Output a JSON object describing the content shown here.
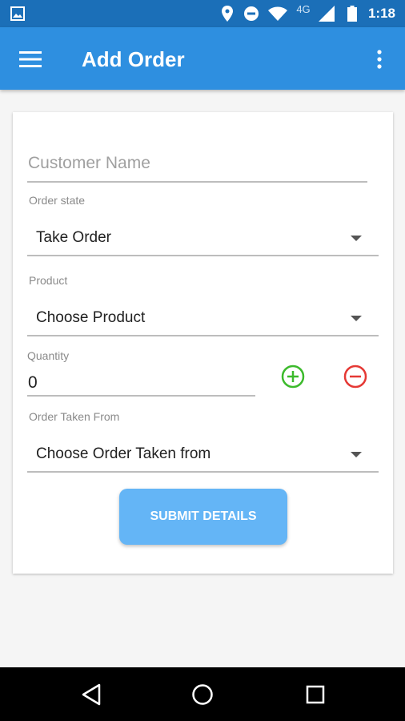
{
  "status_bar": {
    "time": "1:18",
    "network": "4G",
    "icons": [
      "image-icon",
      "location-icon",
      "dnd-icon",
      "wifi-icon",
      "signal-icon",
      "battery-icon"
    ]
  },
  "app_bar": {
    "title": "Add Order",
    "background": "#2e8fe0",
    "icons": [
      "menu-icon",
      "more-vert-icon"
    ]
  },
  "form": {
    "customer_name": {
      "placeholder": "Customer Name",
      "value": ""
    },
    "order_state": {
      "label": "Order state",
      "value": "Take Order"
    },
    "product": {
      "label": "Product",
      "value": "Choose Product"
    },
    "quantity": {
      "label": "Quantity",
      "value": "0",
      "add_color": "#3cba2c",
      "remove_color": "#e53935"
    },
    "order_taken_from": {
      "label": "Order Taken From",
      "value": "Choose Order Taken from"
    },
    "submit_label": "SUBMIT DETAILS",
    "submit_color": "#64b5f6"
  },
  "nav_bar": {
    "icons": [
      "back-icon",
      "home-icon",
      "recents-icon"
    ]
  }
}
